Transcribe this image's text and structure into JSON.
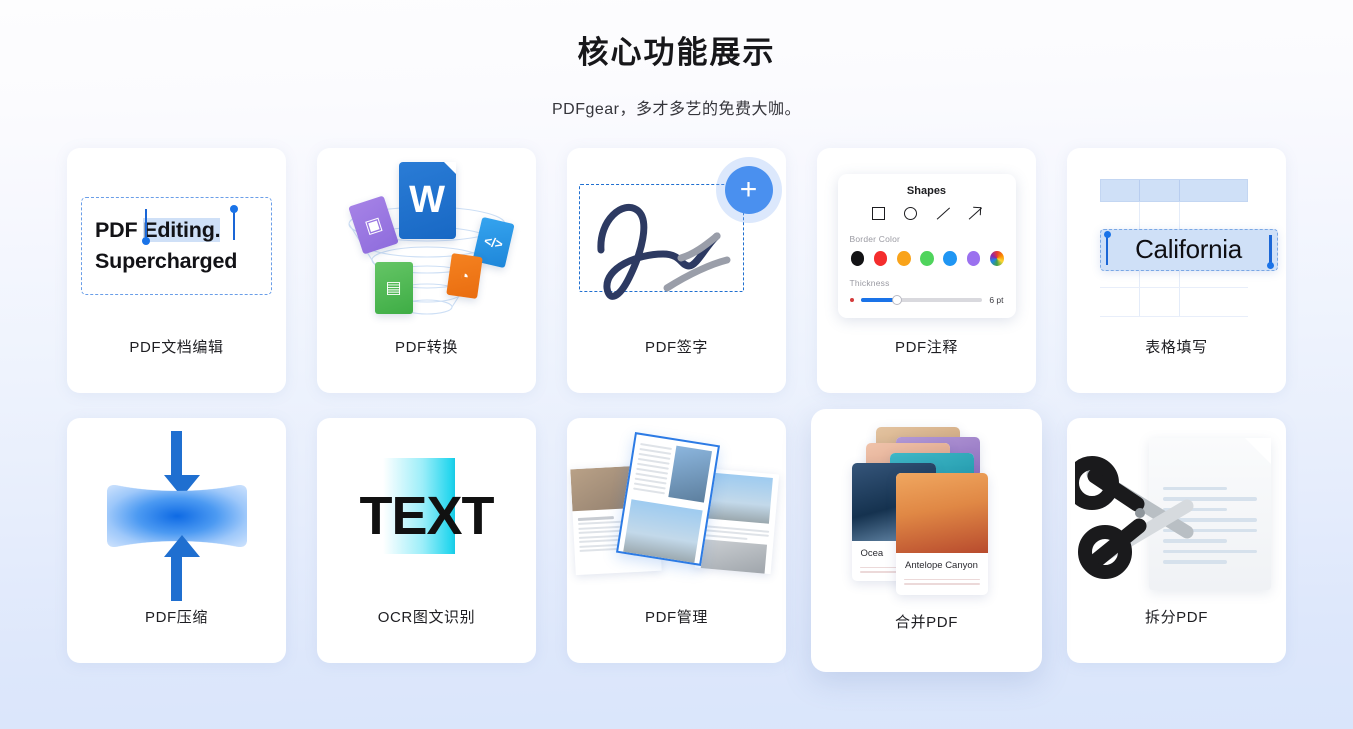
{
  "header": {
    "title": "核心功能展示",
    "subtitle": "PDFgear，多才多艺的免费大咖。"
  },
  "cards": [
    {
      "id": "pdf-editing",
      "label": "PDF文档编辑",
      "visual": {
        "line1_a": "PDF ",
        "line1_b": "Editing.",
        "line2": "Supercharged"
      }
    },
    {
      "id": "pdf-convert",
      "label": "PDF转换",
      "visual": {
        "word": "W",
        "image_glyph": "▣",
        "code_glyph": "</>",
        "ppt_glyph": "◔",
        "excel_glyph": "▤"
      }
    },
    {
      "id": "pdf-sign",
      "label": "PDF签字",
      "visual": {
        "add_label": "+"
      }
    },
    {
      "id": "pdf-annotate",
      "label": "PDF注释",
      "visual": {
        "panel_title": "Shapes",
        "border_color_label": "Border Color",
        "thickness_label": "Thickness",
        "thickness_value": "6 pt",
        "shapes": [
          "square",
          "circle",
          "line",
          "arrow"
        ],
        "swatches": [
          "#131315",
          "#f42d2d",
          "#f9a31a",
          "#4fd45c",
          "#2096f3",
          "#9b71ef",
          "rainbow"
        ]
      }
    },
    {
      "id": "form-fill",
      "label": "表格填写",
      "visual": {
        "field_value": "California"
      }
    },
    {
      "id": "pdf-compress",
      "label": "PDF压缩",
      "visual": {}
    },
    {
      "id": "ocr",
      "label": "OCR图文识别",
      "visual": {
        "text": "TEXT"
      }
    },
    {
      "id": "pdf-manage",
      "label": "PDF管理",
      "visual": {}
    },
    {
      "id": "merge-pdf",
      "label": "合并PDF",
      "hovered": true,
      "visual": {
        "caption_back": "Ocea",
        "caption_front": "Antelope Canyon"
      }
    },
    {
      "id": "split-pdf",
      "label": "拆分PDF",
      "visual": {}
    }
  ],
  "colors": {
    "accent": "#1a73e8",
    "card_bg": "#ffffff",
    "page_bg_top": "#fdfdfe",
    "page_bg_bottom": "#d9e5fb",
    "text_primary": "#1b1b1f",
    "dashed_border": "#6a9ee8"
  }
}
